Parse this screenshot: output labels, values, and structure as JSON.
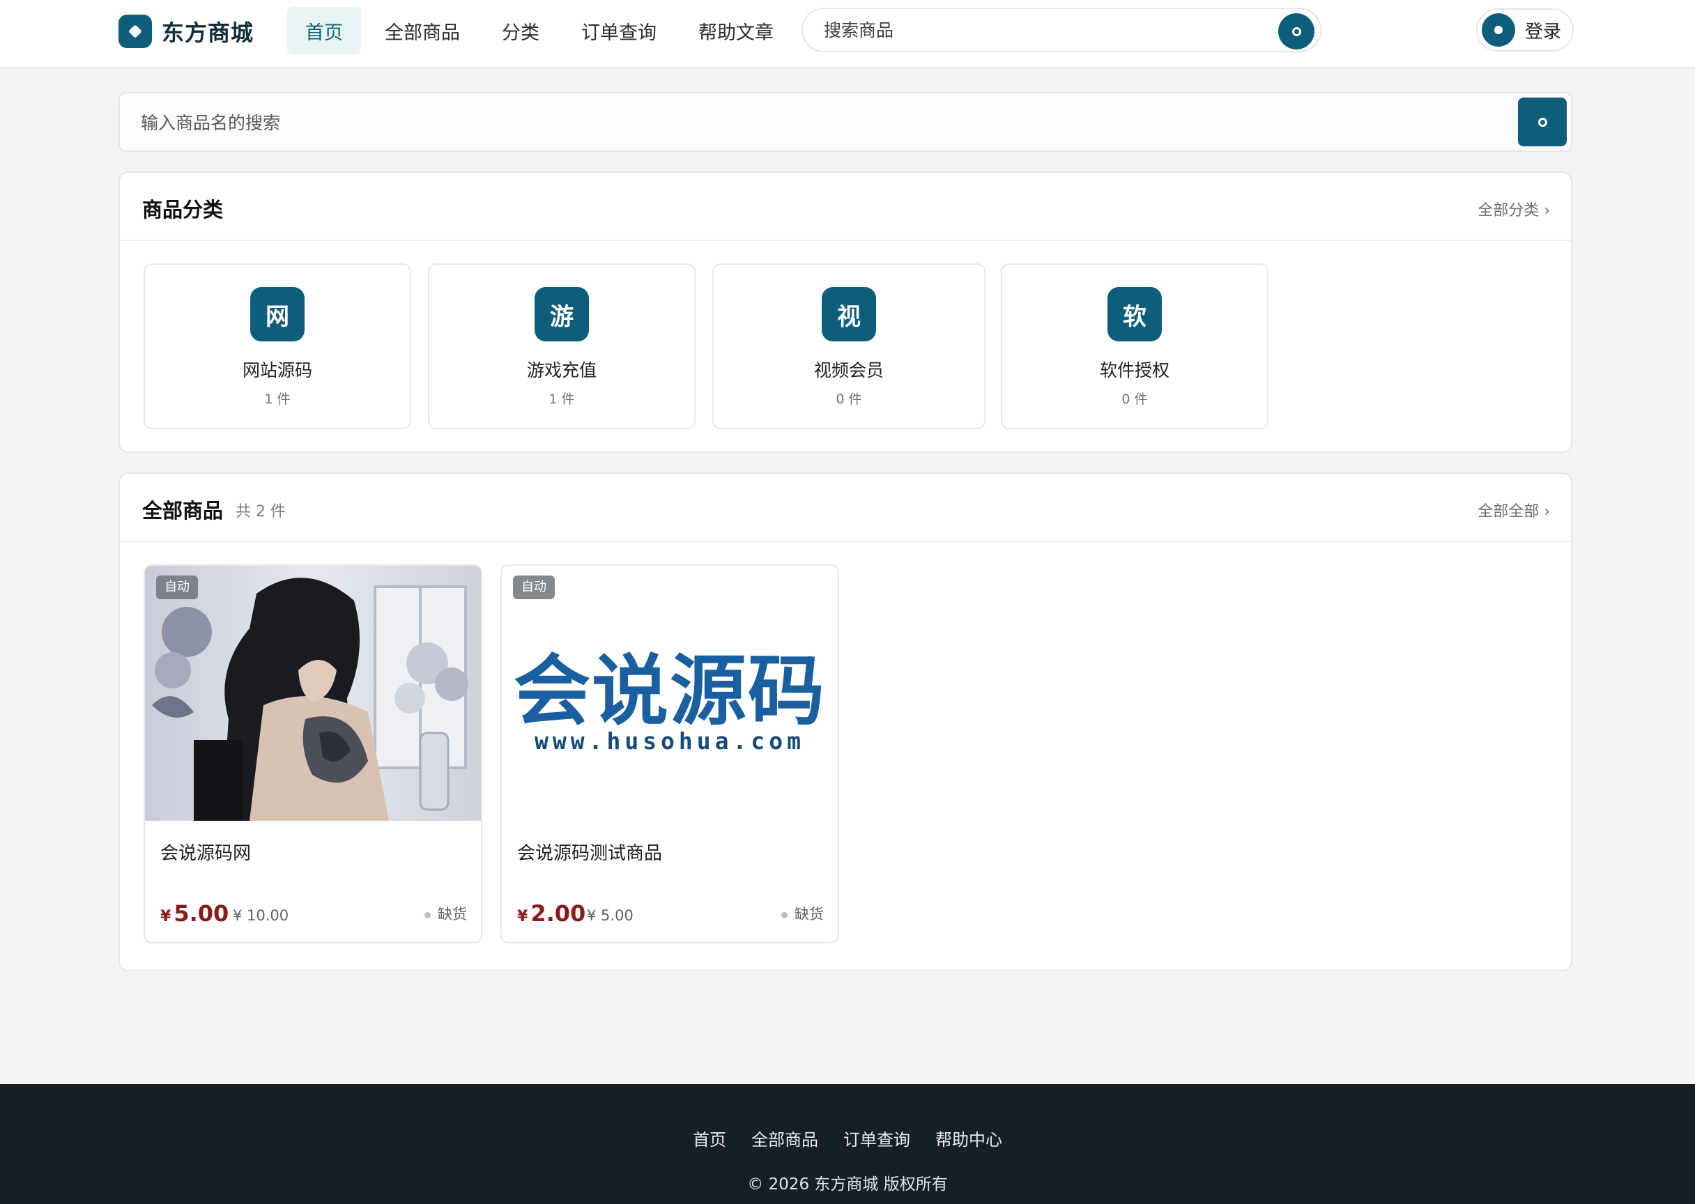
{
  "header": {
    "brand": "东方商城",
    "nav": [
      {
        "label": "首页",
        "active": true
      },
      {
        "label": "全部商品",
        "active": false
      },
      {
        "label": "分类",
        "active": false
      },
      {
        "label": "订单查询",
        "active": false
      },
      {
        "label": "帮助文章",
        "active": false
      }
    ],
    "search_placeholder": "搜索商品",
    "login_label": "登录"
  },
  "main_search": {
    "placeholder": "输入商品名的搜索"
  },
  "categories": {
    "title": "商品分类",
    "more": "全部分类 ›",
    "items": [
      {
        "icon_char": "网",
        "name": "网站源码",
        "count": "1 件"
      },
      {
        "icon_char": "游",
        "name": "游戏充值",
        "count": "1 件"
      },
      {
        "icon_char": "视",
        "name": "视频会员",
        "count": "0 件"
      },
      {
        "icon_char": "软",
        "name": "软件授权",
        "count": "0 件"
      }
    ]
  },
  "products": {
    "title": "全部商品",
    "count": "共 2 件",
    "more": "全部全部 ›",
    "items": [
      {
        "badge": "自动",
        "name": "会说源码网",
        "price_symbol": "¥",
        "price": "5.00",
        "original": "¥ 10.00",
        "stock": "缺货"
      },
      {
        "badge": "自动",
        "name": "会说源码测试商品",
        "price_symbol": "¥",
        "price": "2.00",
        "original": "¥ 5.00",
        "stock": "缺货"
      }
    ],
    "logo_title": "会说源码",
    "logo_url": "www.husohua.com"
  },
  "footer": {
    "links": [
      "首页",
      "全部商品",
      "订单查询",
      "帮助中心"
    ],
    "copyright": "© 2026 东方商城 版权所有"
  },
  "colors": {
    "accent": "#0e5e7b",
    "price": "#8a1b1b",
    "footer_bg": "#141f26"
  }
}
